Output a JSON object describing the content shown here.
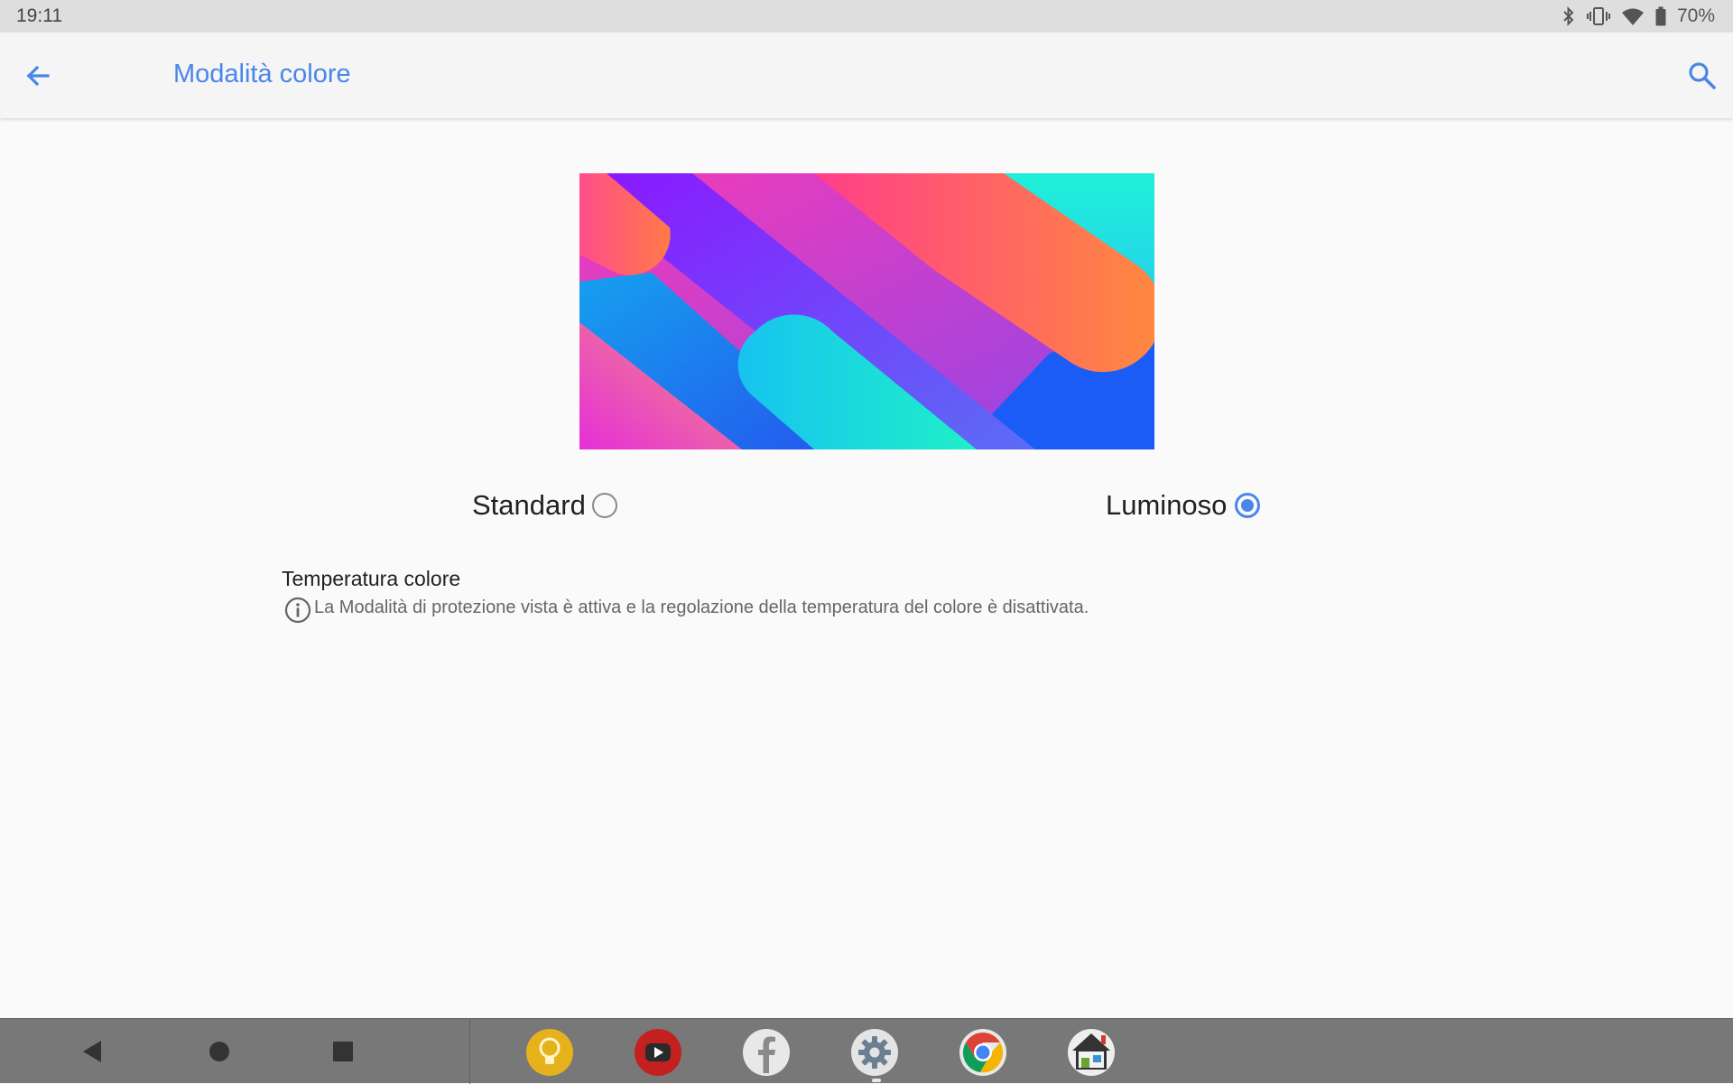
{
  "status_bar": {
    "time": "19:11",
    "battery_percent": "70%",
    "icons": [
      "bluetooth-icon",
      "vibrate-icon",
      "wifi-icon",
      "battery-icon"
    ]
  },
  "app_bar": {
    "title": "Modalità colore",
    "back_icon": "arrow-back-icon",
    "search_icon": "search-icon",
    "accent_color": "#4a86e8"
  },
  "color_modes": {
    "options": [
      {
        "label": "Standard",
        "selected": false
      },
      {
        "label": "Luminoso",
        "selected": true
      }
    ]
  },
  "temperature": {
    "title": "Temperatura colore",
    "info_text": "La Modalità di protezione vista è attiva e la regolazione della temperatura del colore è disattivata.",
    "info_icon": "info-icon"
  },
  "nav_bar": {
    "buttons": [
      "back-triangle-icon",
      "home-circle-icon",
      "recents-square-icon"
    ],
    "dock_apps": [
      "lightbulb-app-icon",
      "youtube-app-icon",
      "facebook-app-icon",
      "settings-app-icon",
      "chrome-app-icon",
      "home-app-icon"
    ],
    "active_app": "settings-app-icon"
  }
}
